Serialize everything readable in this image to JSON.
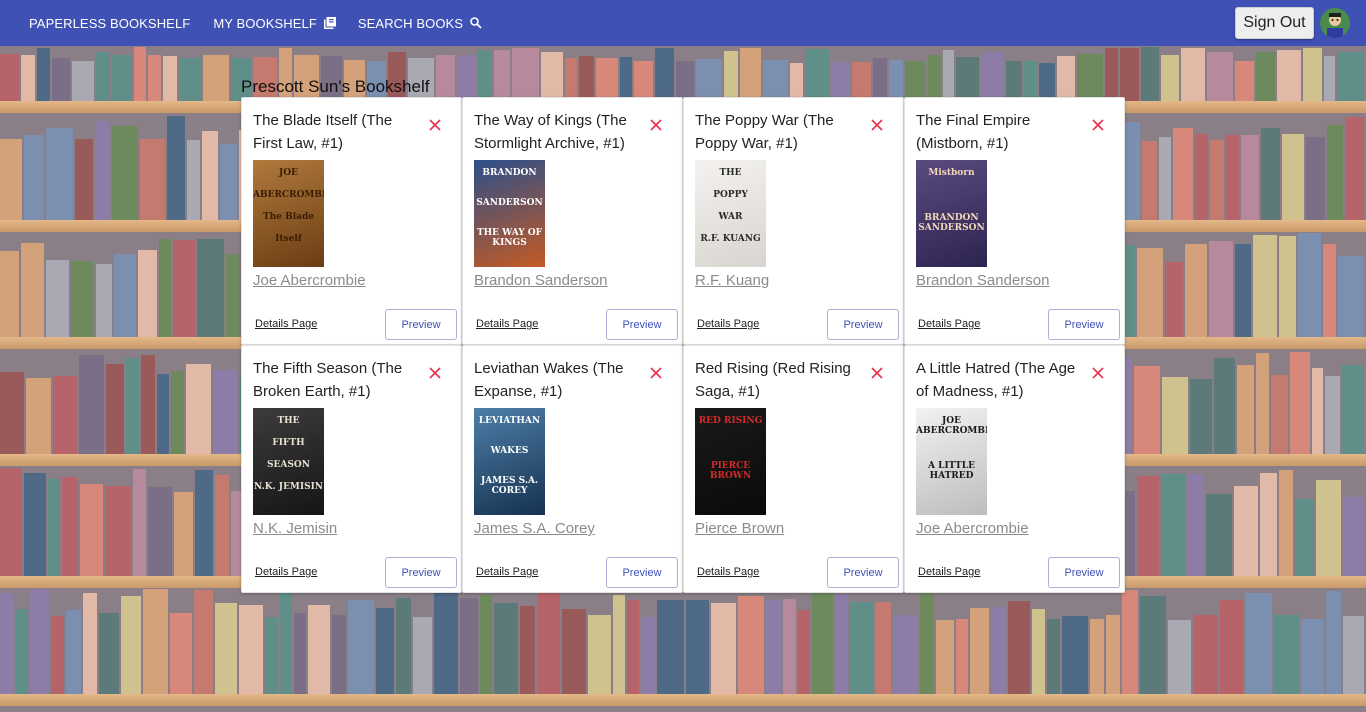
{
  "nav": {
    "brand": "PAPERLESS BOOKSHELF",
    "my_bookshelf": "MY BOOKSHELF",
    "search_books": "SEARCH BOOKS",
    "sign_out": "Sign Out"
  },
  "page": {
    "title": "Prescott Sun's Bookshelf"
  },
  "card_actions": {
    "details": "Details Page",
    "preview": "Preview"
  },
  "books": [
    {
      "title": "The Blade Itself (The First Law, #1)",
      "author": "Joe Abercrombie",
      "cover": {
        "colors": [
          "#b07a3c",
          "#6b3d14"
        ],
        "lines": [
          "JOE",
          "ABERCROMBIE",
          "The Blade",
          "Itself"
        ],
        "text_color": "#3a1c05"
      }
    },
    {
      "title": "The Way of Kings (The Stormlight Archive, #1)",
      "author": "Brandon Sanderson",
      "cover": {
        "colors": [
          "#2b4f8a",
          "#c45a24"
        ],
        "lines": [
          "BRANDON",
          "SANDERSON",
          "THE WAY OF KINGS"
        ],
        "text_color": "#ffffff"
      }
    },
    {
      "title": "The Poppy War (The Poppy War, #1)",
      "author": "R.F. Kuang",
      "cover": {
        "colors": [
          "#f4f2ef",
          "#d8d5d0"
        ],
        "lines": [
          "THE",
          "POPPY",
          "WAR",
          "R.F. KUANG"
        ],
        "text_color": "#2b2b2b"
      }
    },
    {
      "title": "The Final Empire (Mistborn, #1)",
      "author": "Brandon Sanderson",
      "cover": {
        "colors": [
          "#5a4a80",
          "#2d2450"
        ],
        "lines": [
          "Mistborn",
          "BRANDON SANDERSON"
        ],
        "text_color": "#f0d8b8"
      }
    },
    {
      "title": "The Fifth Season (The Broken Earth, #1)",
      "author": "N.K. Jemisin",
      "cover": {
        "colors": [
          "#3c3c3c",
          "#151515"
        ],
        "lines": [
          "THE",
          "FIFTH",
          "SEASON",
          "N.K. JEMISIN"
        ],
        "text_color": "#e8e0d0"
      }
    },
    {
      "title": "Leviathan Wakes (The Expanse, #1)",
      "author": "James S.A. Corey",
      "cover": {
        "colors": [
          "#4d7fa8",
          "#163250"
        ],
        "lines": [
          "LEVIATHAN",
          "WAKES",
          "JAMES S.A. COREY"
        ],
        "text_color": "#ffffff"
      }
    },
    {
      "title": "Red Rising (Red Rising Saga, #1)",
      "author": "Pierce Brown",
      "cover": {
        "colors": [
          "#1a1a1a",
          "#0a0a0a"
        ],
        "lines": [
          "RED RISING",
          "PIERCE BROWN"
        ],
        "text_color": "#d42a2a"
      }
    },
    {
      "title": "A Little Hatred (The Age of Madness, #1)",
      "author": "Joe Abercrombie",
      "cover": {
        "colors": [
          "#f2f2f2",
          "#bdbdbd"
        ],
        "lines": [
          "JOE ABERCROMBIE",
          "A LITTLE HATRED"
        ],
        "text_color": "#1a1a1a"
      }
    }
  ],
  "colors": {
    "navbar": "#3f51b5",
    "remove_x": "#e8384f",
    "author_link": "#8b8b8b",
    "preview_text": "#3f51b5"
  }
}
